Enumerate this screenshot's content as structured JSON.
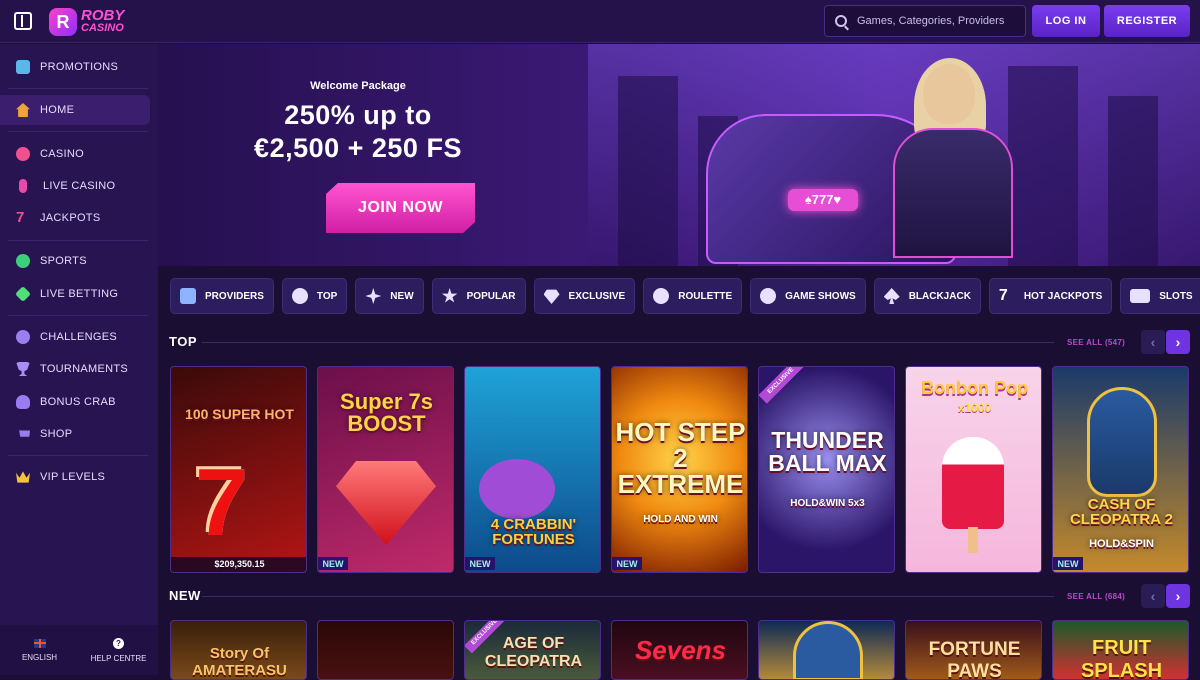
{
  "header": {
    "logo_line1": "ROBY",
    "logo_line2": "CASINO",
    "search_placeholder": "Games, Categories, Providers",
    "login_label": "LOG IN",
    "register_label": "REGISTER"
  },
  "sidebar": {
    "items": [
      {
        "label": "PROMOTIONS",
        "icon": "gift-icon"
      },
      {
        "label": "HOME",
        "icon": "home-icon",
        "active": true
      },
      {
        "label": "CASINO",
        "icon": "casino-chip-icon"
      },
      {
        "label": "LIVE CASINO",
        "icon": "microphone-icon"
      },
      {
        "label": "JACKPOTS",
        "icon": "seven-icon"
      },
      {
        "label": "SPORTS",
        "icon": "soccer-ball-icon"
      },
      {
        "label": "LIVE BETTING",
        "icon": "live-betting-icon"
      },
      {
        "label": "CHALLENGES",
        "icon": "medal-icon"
      },
      {
        "label": "TOURNAMENTS",
        "icon": "trophy-icon"
      },
      {
        "label": "BONUS CRAB",
        "icon": "crab-icon"
      },
      {
        "label": "SHOP",
        "icon": "cart-icon"
      },
      {
        "label": "VIP LEVELS",
        "icon": "crown-icon"
      }
    ],
    "footer": {
      "language_label": "ENGLISH",
      "help_label": "HELP CENTRE",
      "help_glyph": "?"
    }
  },
  "hero": {
    "subtitle": "Welcome Package",
    "line1": "250% up to",
    "line2": "€2,500 + 250 FS",
    "cta_label": "JOIN NOW",
    "bike_plate": "♠777♥"
  },
  "categories": [
    {
      "label": "PROVIDERS",
      "icon": "folder-icon"
    },
    {
      "label": "TOP",
      "icon": "award-icon"
    },
    {
      "label": "NEW",
      "icon": "sparkle-icon"
    },
    {
      "label": "POPULAR",
      "icon": "star-icon"
    },
    {
      "label": "EXCLUSIVE",
      "icon": "diamond-icon"
    },
    {
      "label": "ROULETTE",
      "icon": "roulette-icon"
    },
    {
      "label": "GAME SHOWS",
      "icon": "wheel-icon"
    },
    {
      "label": "BLACKJACK",
      "icon": "spade-icon"
    },
    {
      "label": "HOT JACKPOTS",
      "icon": "seven-icon"
    },
    {
      "label": "SLOTS",
      "icon": "slots-icon"
    },
    {
      "label": "",
      "icon": "cherry-icon"
    }
  ],
  "sections": {
    "top": {
      "title": "TOP",
      "see_all": "SEE ALL (547)"
    },
    "new": {
      "title": "NEW",
      "see_all": "SEE ALL (684)"
    }
  },
  "top_games": [
    {
      "title": "100 SUPER HOT",
      "jackpot": "$209,350.15",
      "colors": [
        "#3a0a0a",
        "#b51515"
      ]
    },
    {
      "title": "Super 7s BOOST",
      "badge": "NEW",
      "colors": [
        "#6b0f4a",
        "#c02a6a"
      ]
    },
    {
      "title": "4 CRABBIN' FORTUNES",
      "badge": "NEW",
      "colors": [
        "#0d4a8a",
        "#1f9ad3"
      ]
    },
    {
      "title": "HOT STEP 2 EXTREME",
      "subtitle": "HOLD AND WIN",
      "badge": "NEW",
      "colors": [
        "#7a1a00",
        "#f08a10"
      ]
    },
    {
      "title": "THUNDER BALL MAX",
      "subtitle": "HOLD&WIN 5x3",
      "tag": "EXCLUSIVE",
      "colors": [
        "#2a1568",
        "#6a5fd6"
      ]
    },
    {
      "title": "Bonbon Pop",
      "subtitle": "x1000",
      "colors": [
        "#f6b6dc",
        "#f7d4ea"
      ]
    },
    {
      "title": "CASH OF CLEOPATRA 2",
      "subtitle": "HOLD&SPIN",
      "badge": "NEW",
      "colors": [
        "#1a3a6a",
        "#c48a2a"
      ]
    }
  ],
  "new_games": [
    {
      "title": "Story Of AMATERASU",
      "colors": [
        "#3a1f0a",
        "#7a4a1a"
      ]
    },
    {
      "title": "",
      "colors": [
        "#2a0808",
        "#4a1010"
      ]
    },
    {
      "title": "AGE OF CLEOPATRA",
      "tag": "EXCLUSIVE",
      "colors": [
        "#1a2a3a",
        "#4a5a3a"
      ]
    },
    {
      "title": "Sevens",
      "colors": [
        "#200610",
        "#4a0f20"
      ]
    },
    {
      "title": "",
      "colors": [
        "#0e2a55",
        "#b58a3a"
      ]
    },
    {
      "title": "FORTUNE PAWS",
      "colors": [
        "#3a0f1a",
        "#a05a1a"
      ]
    },
    {
      "title": "FRUIT SPLASH",
      "colors": [
        "#1a5a2a",
        "#d43030"
      ]
    }
  ],
  "colors": {
    "accent": "#6e34e0",
    "pink": "#ff4fd6",
    "bg": "#1a0f33",
    "sidebar": "#281451"
  }
}
